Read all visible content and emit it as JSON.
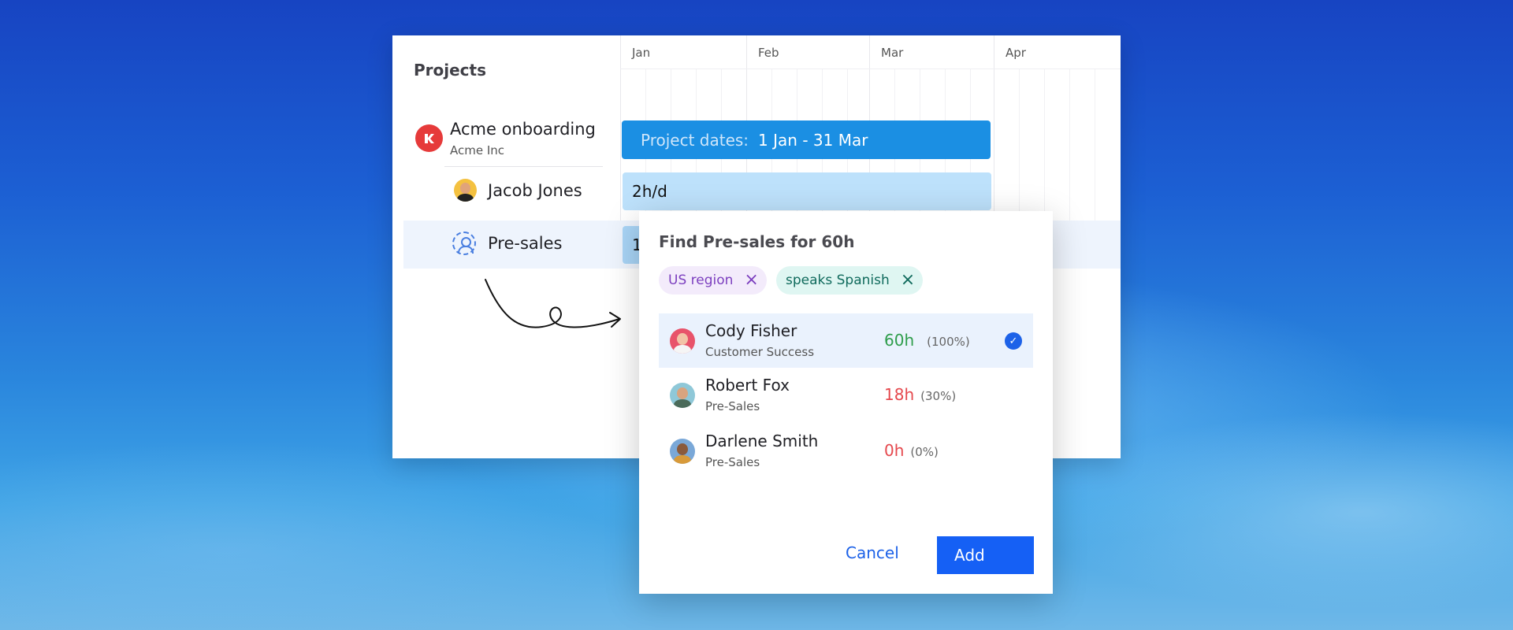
{
  "colors": {
    "brand_blue": "#1560f5",
    "project_bar": "#1b8fe3",
    "hours_bar": "#bde1fb",
    "hours_green": "#2e9d4b",
    "hours_red": "#e5484d",
    "project_avatar": "#e63a3a"
  },
  "planner": {
    "title": "Projects",
    "months": [
      "Jan",
      "Feb",
      "Mar",
      "Apr"
    ],
    "project": {
      "name": "Acme onboarding",
      "client": "Acme Inc",
      "avatar_icon": "acme-logo-icon",
      "bar_label": "Project dates:",
      "bar_value": "1 Jan - 31 Mar"
    },
    "person": {
      "name": "Jacob Jones",
      "allocation": "2h/d"
    },
    "role": {
      "name": "Pre-sales",
      "icon": "user-placeholder-icon",
      "allocation": "1"
    }
  },
  "dialog": {
    "title": "Find Pre-sales for 60h",
    "filters": [
      {
        "label": "US region",
        "remove_icon": "close-icon"
      },
      {
        "label": "speaks Spanish",
        "remove_icon": "close-icon"
      }
    ],
    "candidates": [
      {
        "name": "Cody Fisher",
        "role": "Customer Success",
        "hours": "60h",
        "percent": "(100%)",
        "selected": true
      },
      {
        "name": "Robert Fox",
        "role": "Pre-Sales",
        "hours": "18h",
        "percent": "(30%)",
        "selected": false
      },
      {
        "name": "Darlene Smith",
        "role": "Pre-Sales",
        "hours": "0h",
        "percent": "(0%)",
        "selected": false
      }
    ],
    "cancel_label": "Cancel",
    "add_label": "Add"
  }
}
